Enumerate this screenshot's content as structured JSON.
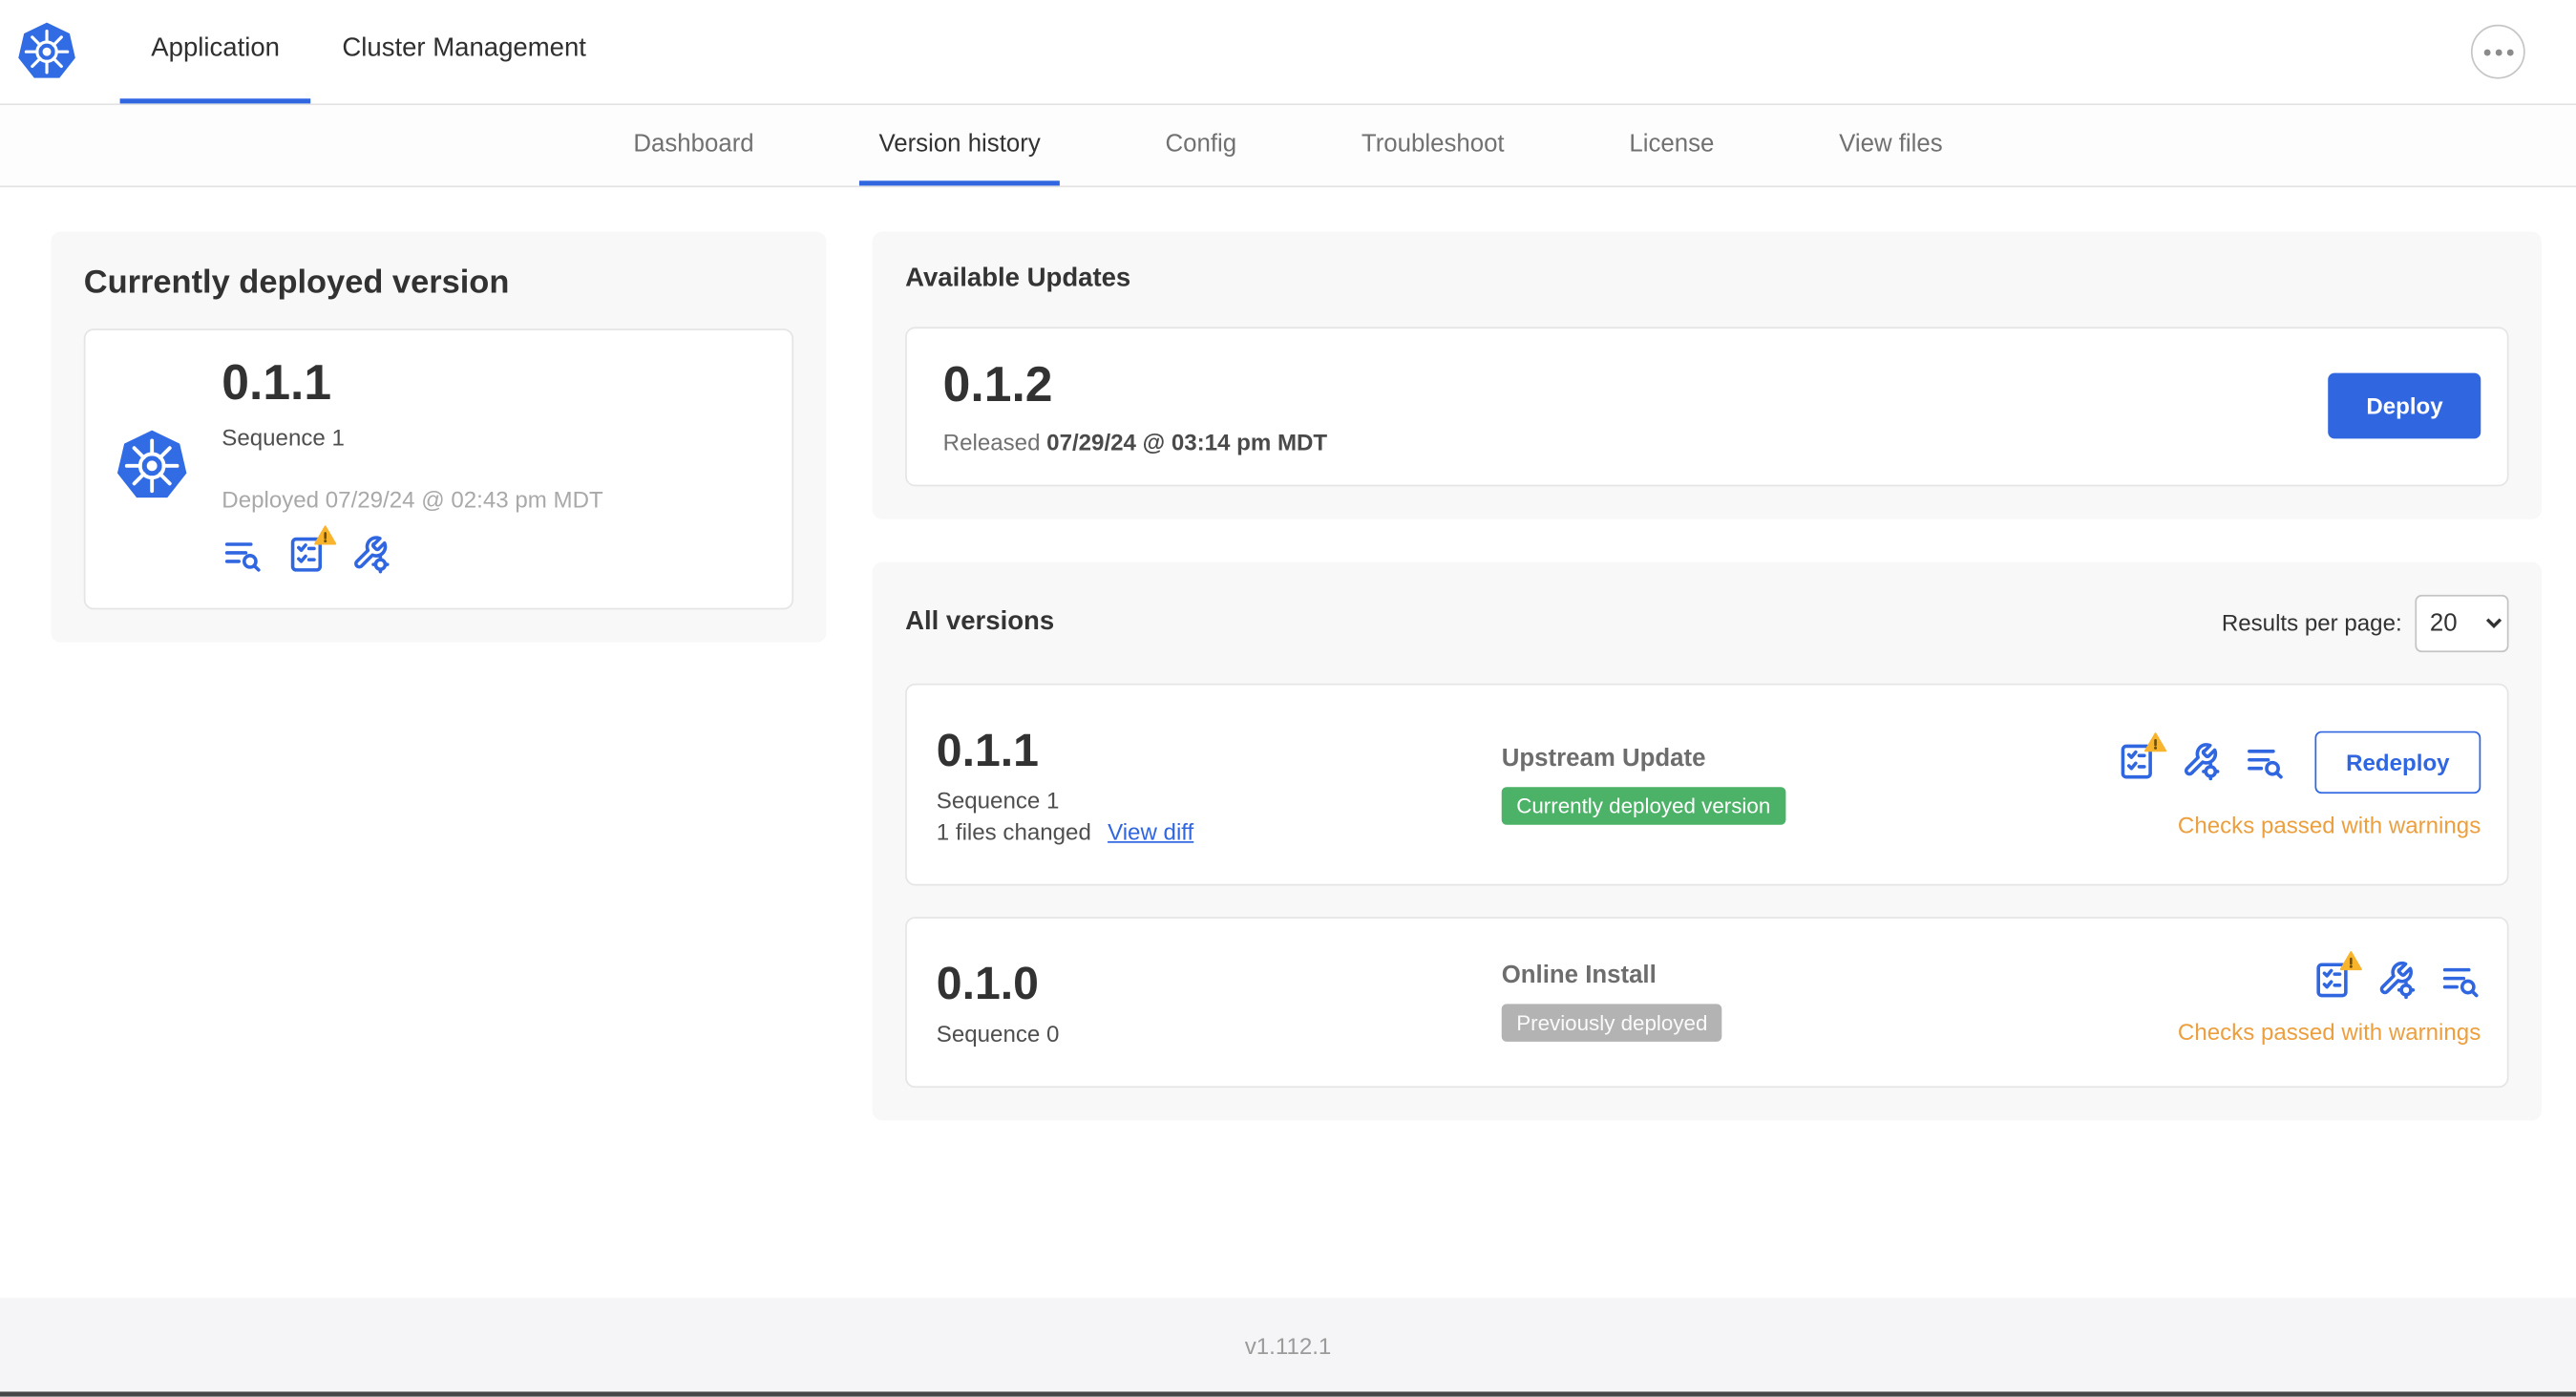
{
  "app": {
    "footer_version": "v1.112.1"
  },
  "topnav": {
    "tabs": [
      {
        "label": "Application",
        "active": true
      },
      {
        "label": "Cluster Management",
        "active": false
      }
    ]
  },
  "subnav": {
    "tabs": [
      {
        "label": "Dashboard",
        "active": false
      },
      {
        "label": "Version history",
        "active": true
      },
      {
        "label": "Config",
        "active": false
      },
      {
        "label": "Troubleshoot",
        "active": false
      },
      {
        "label": "License",
        "active": false
      },
      {
        "label": "View files",
        "active": false
      }
    ]
  },
  "currently_deployed": {
    "title": "Currently deployed version",
    "version": "0.1.1",
    "sequence": "Sequence 1",
    "deployed_at": "Deployed 07/29/24 @ 02:43 pm MDT",
    "icons": [
      "release-notes-icon",
      "preflight-checks-warning-icon",
      "config-icon"
    ]
  },
  "available_updates": {
    "title": "Available Updates",
    "version": "0.1.2",
    "released_prefix": "Released",
    "released_at": "07/29/24 @ 03:14 pm MDT",
    "deploy_button": "Deploy"
  },
  "all_versions": {
    "title": "All versions",
    "results_per_page_label": "Results per page:",
    "results_per_page": "20",
    "rows": [
      {
        "version": "0.1.1",
        "sequence": "Sequence 1",
        "files_changed": "1 files changed",
        "view_diff_label": "View diff",
        "source": "Upstream Update",
        "status_badge": "Currently deployed version",
        "badge_color": "#4cb267",
        "action_button": "Redeploy",
        "checks_status": "Checks passed with warnings",
        "icons": [
          "preflight-checks-warning-icon",
          "config-icon",
          "release-notes-icon"
        ]
      },
      {
        "version": "0.1.0",
        "sequence": "Sequence 0",
        "source": "Online Install",
        "status_badge": "Previously deployed",
        "badge_color": "#b3b3b3",
        "checks_status": "Checks passed with warnings",
        "icons": [
          "preflight-checks-warning-icon",
          "config-icon",
          "release-notes-icon"
        ]
      }
    ]
  },
  "colors": {
    "accent_blue": "#3066e0",
    "kubernetes_blue": "#326ce5",
    "deployed_green": "#4cb267",
    "previously_deployed_gray": "#b3b3b3",
    "warning_text_orange": "#ec9f3e",
    "warning_triangle_yellow": "#f8b42c"
  }
}
